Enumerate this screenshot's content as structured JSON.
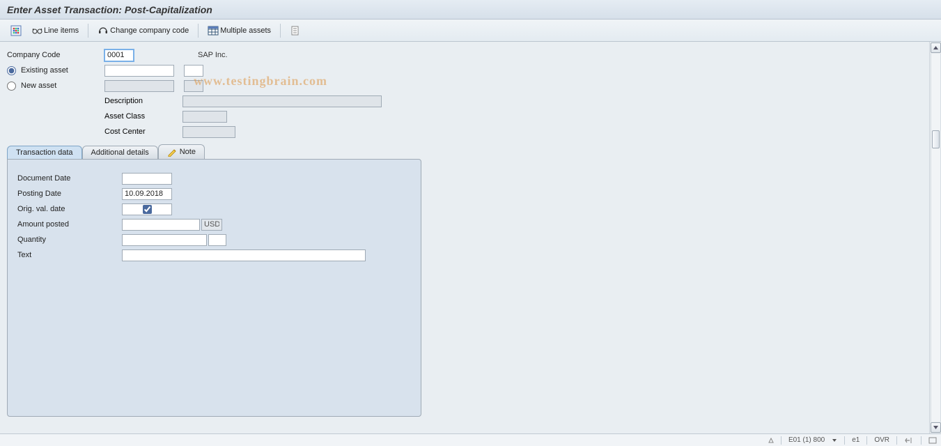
{
  "title": "Enter Asset Transaction: Post-Capitalization",
  "toolbar": {
    "line_items": "Line items",
    "change_company_code": "Change company code",
    "multiple_assets": "Multiple assets"
  },
  "header": {
    "company_code_label": "Company Code",
    "company_code_value": "0001",
    "company_name": "SAP Inc.",
    "existing_asset_label": "Existing asset",
    "new_asset_label": "New asset",
    "description_label": "Description",
    "asset_class_label": "Asset Class",
    "cost_center_label": "Cost Center"
  },
  "tabs": {
    "transaction_data": "Transaction data",
    "additional_details": "Additional details",
    "note": "Note"
  },
  "transaction": {
    "document_date_label": "Document Date",
    "document_date_value": "",
    "posting_date_label": "Posting Date",
    "posting_date_value": "10.09.2018",
    "orig_val_date_label": "Orig. val. date",
    "orig_val_checked": true,
    "amount_posted_label": "Amount posted",
    "amount_posted_value": "",
    "currency": "USD",
    "quantity_label": "Quantity",
    "quantity_value": "",
    "quantity_unit": "",
    "text_label": "Text",
    "text_value": ""
  },
  "status": {
    "session": "E01 (1) 800",
    "client": "e1",
    "mode": "OVR"
  },
  "watermark": "www.testingbrain.com"
}
